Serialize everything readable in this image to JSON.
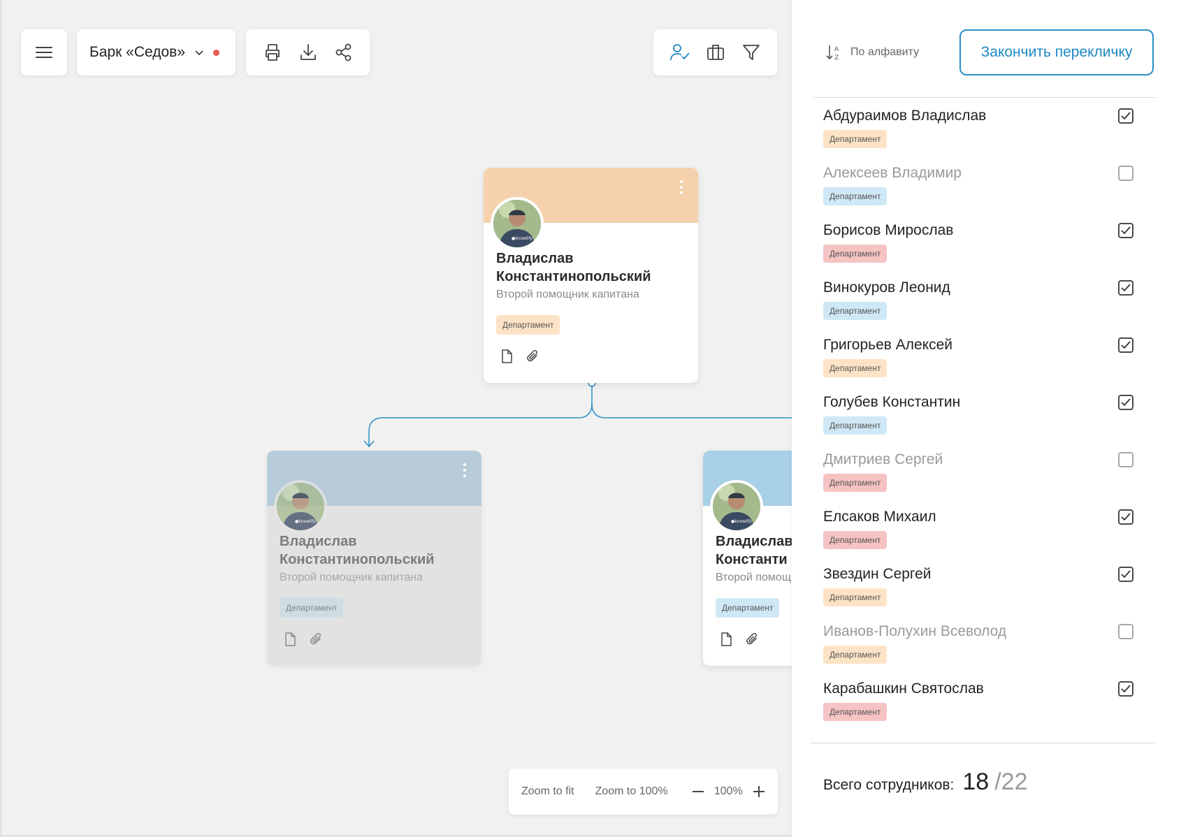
{
  "toolbar": {
    "ship_name": "Барк «Седов»"
  },
  "cards": {
    "top": {
      "name_line1": "Владислав",
      "name_line2": "Константинопольский",
      "role": "Второй помощник капитана",
      "tag": "Департамент"
    },
    "left": {
      "name_line1": "Владислав",
      "name_line2": "Константинопольский",
      "role": "Второй помощник капитана",
      "tag": "Департамент"
    },
    "right": {
      "name_line1": "Владислав",
      "name_line2": "Константи",
      "role": "Второй помощн",
      "tag": "Департамент"
    }
  },
  "zoom": {
    "fit_label": "Zoom to fit",
    "full_label": "Zoom to 100%",
    "value": "100%"
  },
  "panel": {
    "sort_label": "По алфавиту",
    "finish_label": "Закончить перекличку",
    "total_label": "Всего сотрудников:",
    "total_checked": "18",
    "total_all": "/22",
    "people": [
      {
        "name": "Абдураимов Владислав",
        "tag": "Департамент",
        "tag_color": "orange",
        "checked": true
      },
      {
        "name": "Алексеев Владимир",
        "tag": "Департамент",
        "tag_color": "blue",
        "checked": false
      },
      {
        "name": "Борисов Мирослав",
        "tag": "Департамент",
        "tag_color": "red",
        "checked": true
      },
      {
        "name": "Винокуров Леонид",
        "tag": "Департамент",
        "tag_color": "blue",
        "checked": true
      },
      {
        "name": "Григорьев Алексей",
        "tag": "Департамент",
        "tag_color": "orange",
        "checked": true
      },
      {
        "name": "Голубев Константин",
        "tag": "Департамент",
        "tag_color": "blue",
        "checked": true
      },
      {
        "name": "Дмитриев Сергей",
        "tag": "Департамент",
        "tag_color": "red",
        "checked": false
      },
      {
        "name": "Елсаков Михаил",
        "tag": "Департамент",
        "tag_color": "red",
        "checked": true
      },
      {
        "name": "Звездин Сергей",
        "tag": "Департамент",
        "tag_color": "orange",
        "checked": true
      },
      {
        "name": "Иванов-Полухин Всеволод",
        "tag": "Департамент",
        "tag_color": "orange",
        "checked": false
      },
      {
        "name": "Карабашкин Святослав",
        "tag": "Департамент",
        "tag_color": "red",
        "checked": true
      }
    ]
  },
  "colors": {
    "accent": "#1e88c2",
    "connector": "#2a8fc4",
    "tag_orange": "#fde3c6",
    "tag_blue": "#cfe8f6",
    "tag_red": "#f6c3c3",
    "status_dot": "#e85a4f"
  }
}
